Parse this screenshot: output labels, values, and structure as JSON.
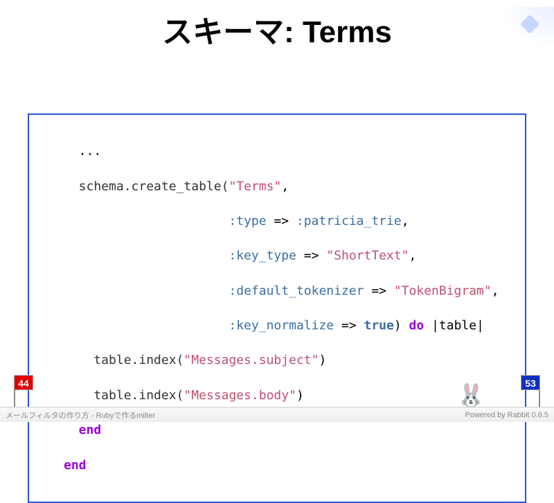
{
  "title": "スキーマ: Terms",
  "code": {
    "l1": "  ...",
    "l2a": "  schema.create_table(",
    "l2b": "\"Terms\"",
    "l2c": ",",
    "l3a": "                      :type",
    "l3b": " => ",
    "l3c": ":patricia_trie",
    "l3d": ",",
    "l4a": "                      :key_type",
    "l4b": " => ",
    "l4c": "\"ShortText\"",
    "l4d": ",",
    "l5a": "                      :default_tokenizer",
    "l5b": " => ",
    "l5c": "\"TokenBigram\"",
    "l5d": ",",
    "l6a": "                      :key_normalize",
    "l6b": " => ",
    "l6c": "true",
    "l6d": ") ",
    "l6e": "do",
    "l6f": " |table|",
    "l7a": "    table.index(",
    "l7b": "\"Messages.subject\"",
    "l7c": ")",
    "l8a": "    table.index(",
    "l8b": "\"Messages.body\"",
    "l8c": ")",
    "l9": "  end",
    "l10": "end"
  },
  "slide_current": "44",
  "slide_total": "53",
  "footer_left": "メールフィルタの作り方 - Rubyで作るmilter",
  "footer_right": "Powered by Rabbit 0.6.5"
}
